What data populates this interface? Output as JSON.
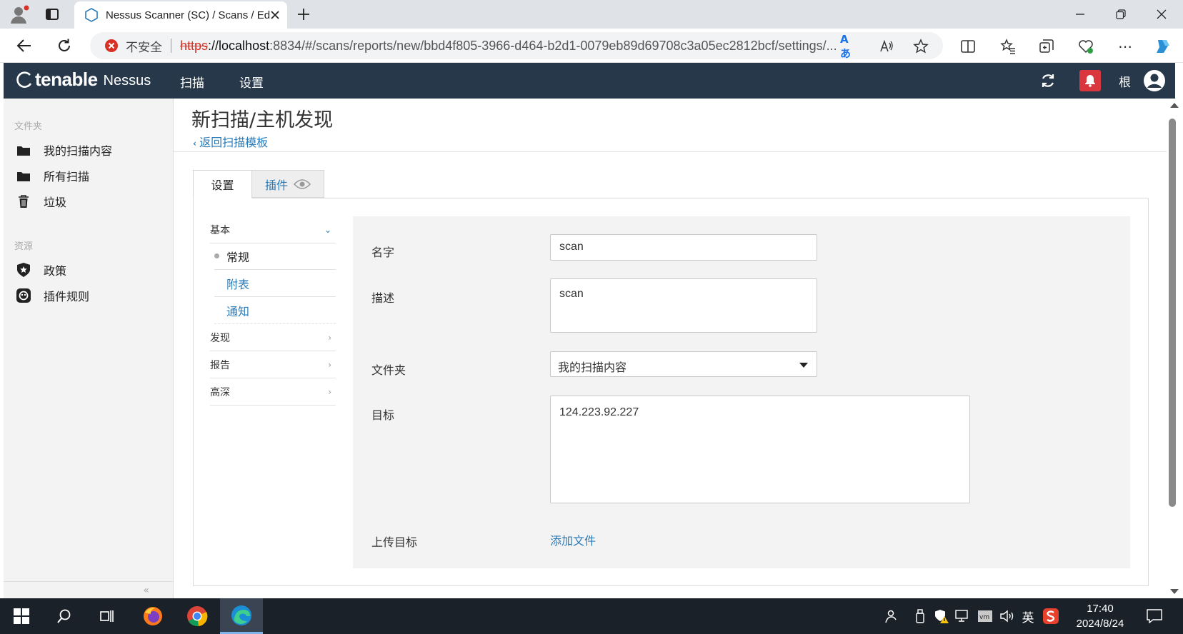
{
  "browser": {
    "tab_title": "Nessus Scanner (SC) / Scans / Edit",
    "security_label": "不安全",
    "url_protocol": "https",
    "url_host": "://localhost",
    "url_rest": ":8834/#/scans/reports/new/bbd4f805-3966-d464-b2d1-0079eb89d69708c3a05ec2812bcf/settings/...",
    "read_aloud_icon": "Aあ"
  },
  "header": {
    "logo_tenable": "tenable",
    "logo_nessus": "Nessus",
    "nav_scans": "扫描",
    "nav_settings": "设置",
    "user_name": "根"
  },
  "sidebar": {
    "folders_heading": "文件夹",
    "folders": [
      {
        "label": "我的扫描内容",
        "icon": "folder-icon"
      },
      {
        "label": "所有扫描",
        "icon": "folder-icon"
      },
      {
        "label": "垃圾",
        "icon": "trash-icon"
      }
    ],
    "resources_heading": "资源",
    "resources": [
      {
        "label": "政策",
        "icon": "shield-icon"
      },
      {
        "label": "插件规则",
        "icon": "plugin-rules-icon"
      }
    ],
    "collapse_label": "«"
  },
  "page": {
    "title": "新扫描/主机发现",
    "back_link": "返回扫描模板"
  },
  "tabs": {
    "settings": "设置",
    "plugins": "插件"
  },
  "settings_nav": {
    "basic": "基本",
    "basic_items": [
      "常规",
      "附表",
      "通知"
    ],
    "discovery": "发现",
    "report": "报告",
    "advanced": "高深"
  },
  "form": {
    "name_label": "名字",
    "name_value": "scan",
    "description_label": "描述",
    "description_value": "scan",
    "folder_label": "文件夹",
    "folder_value": "我的扫描内容",
    "targets_label": "目标",
    "targets_value": "124.223.92.227",
    "upload_label": "上传目标",
    "add_file": "添加文件"
  },
  "taskbar": {
    "time": "17:40",
    "date": "2024/8/24",
    "ime": "英"
  },
  "colors": {
    "header_bg": "#263849",
    "link": "#2a7ab8",
    "bell": "#d9363e"
  }
}
